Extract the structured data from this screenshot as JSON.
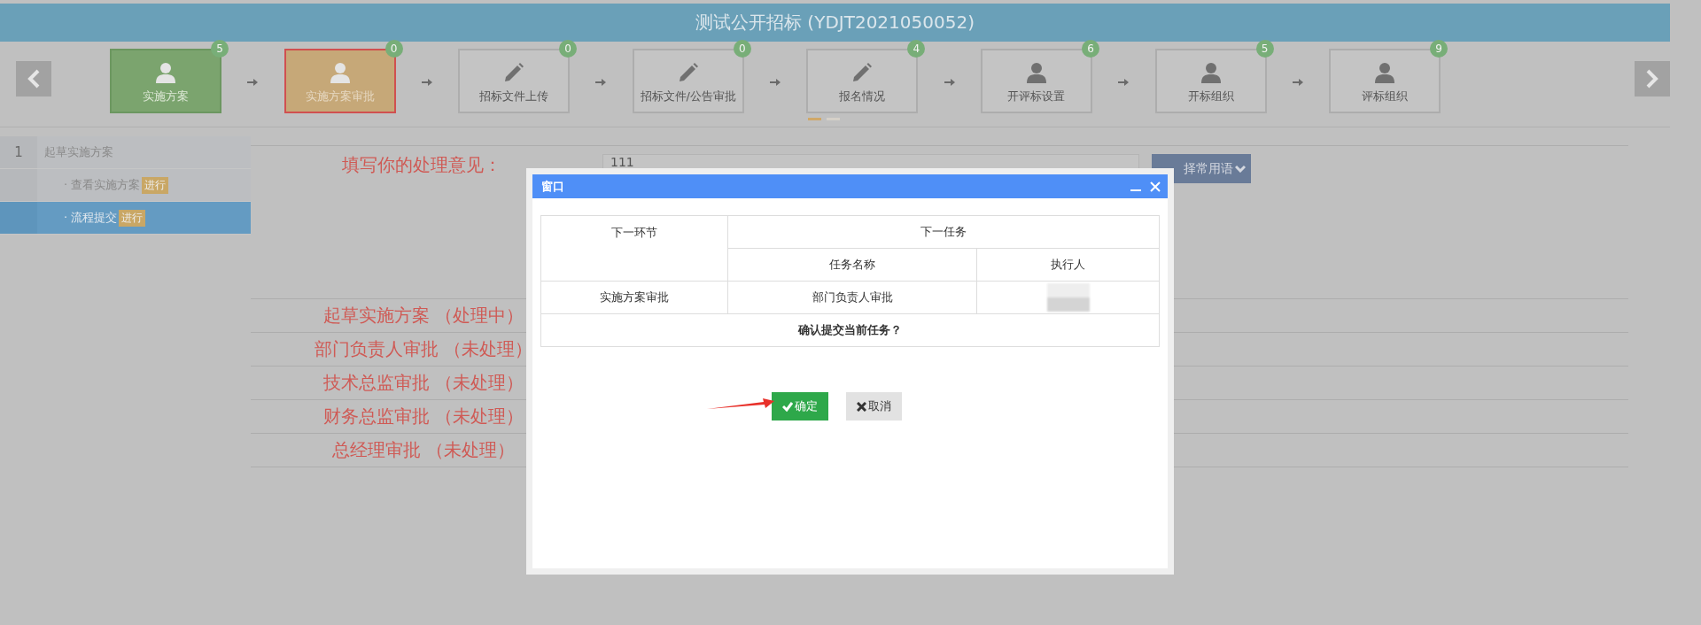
{
  "header": {
    "title": "测试公开招标 (YDJT2021050052)"
  },
  "steps": [
    {
      "label": "实施方案",
      "count": "5",
      "kind": "user",
      "done": true,
      "selected": false
    },
    {
      "label": "实施方案审批",
      "count": "0",
      "kind": "user",
      "done": false,
      "selected": true
    },
    {
      "label": "招标文件上传",
      "count": "0",
      "kind": "edit",
      "done": false,
      "selected": false
    },
    {
      "label": "招标文件/公告审批",
      "count": "0",
      "kind": "edit",
      "done": false,
      "selected": false
    },
    {
      "label": "报名情况",
      "count": "4",
      "kind": "edit",
      "done": false,
      "selected": false
    },
    {
      "label": "开评标设置",
      "count": "6",
      "kind": "user",
      "done": false,
      "selected": false
    },
    {
      "label": "开标组织",
      "count": "5",
      "kind": "user",
      "done": false,
      "selected": false
    },
    {
      "label": "评标组织",
      "count": "9",
      "kind": "user",
      "done": false,
      "selected": false
    }
  ],
  "pager": [
    {
      "selected": true
    },
    {
      "selected": false
    }
  ],
  "sidebar": {
    "items": [
      {
        "number": "1",
        "label": "起草实施方案",
        "selected": false,
        "children": [
          {
            "label": "· 查看实施方案",
            "badge": "进行",
            "selected": false
          },
          {
            "label": "· 流程提交",
            "badge": "进行",
            "selected": true
          }
        ]
      }
    ]
  },
  "form": {
    "opinion_label": "填写你的处理意见：",
    "opinion_value": "111",
    "phrase_button": "择常用语"
  },
  "flow": [
    {
      "text": "起草实施方案 （处理中）"
    },
    {
      "text": "部门负责人审批 （未处理）"
    },
    {
      "text": "技术总监审批 （未处理）"
    },
    {
      "text": "财务总监审批 （未处理）"
    },
    {
      "text": "总经理审批 （未处理）"
    }
  ],
  "dialog": {
    "title": "窗口",
    "columns": {
      "next_step": "下一环节",
      "next_task": "下一任务",
      "task_name": "任务名称",
      "executor": "执行人"
    },
    "rows": [
      {
        "next_step": "实施方案审批",
        "task_name": "部门负责人审批"
      }
    ],
    "confirm_text": "确认提交当前任务？",
    "buttons": [
      {
        "label": "确定",
        "kind": "ok"
      },
      {
        "label": "取消",
        "kind": "cancel"
      }
    ]
  }
}
